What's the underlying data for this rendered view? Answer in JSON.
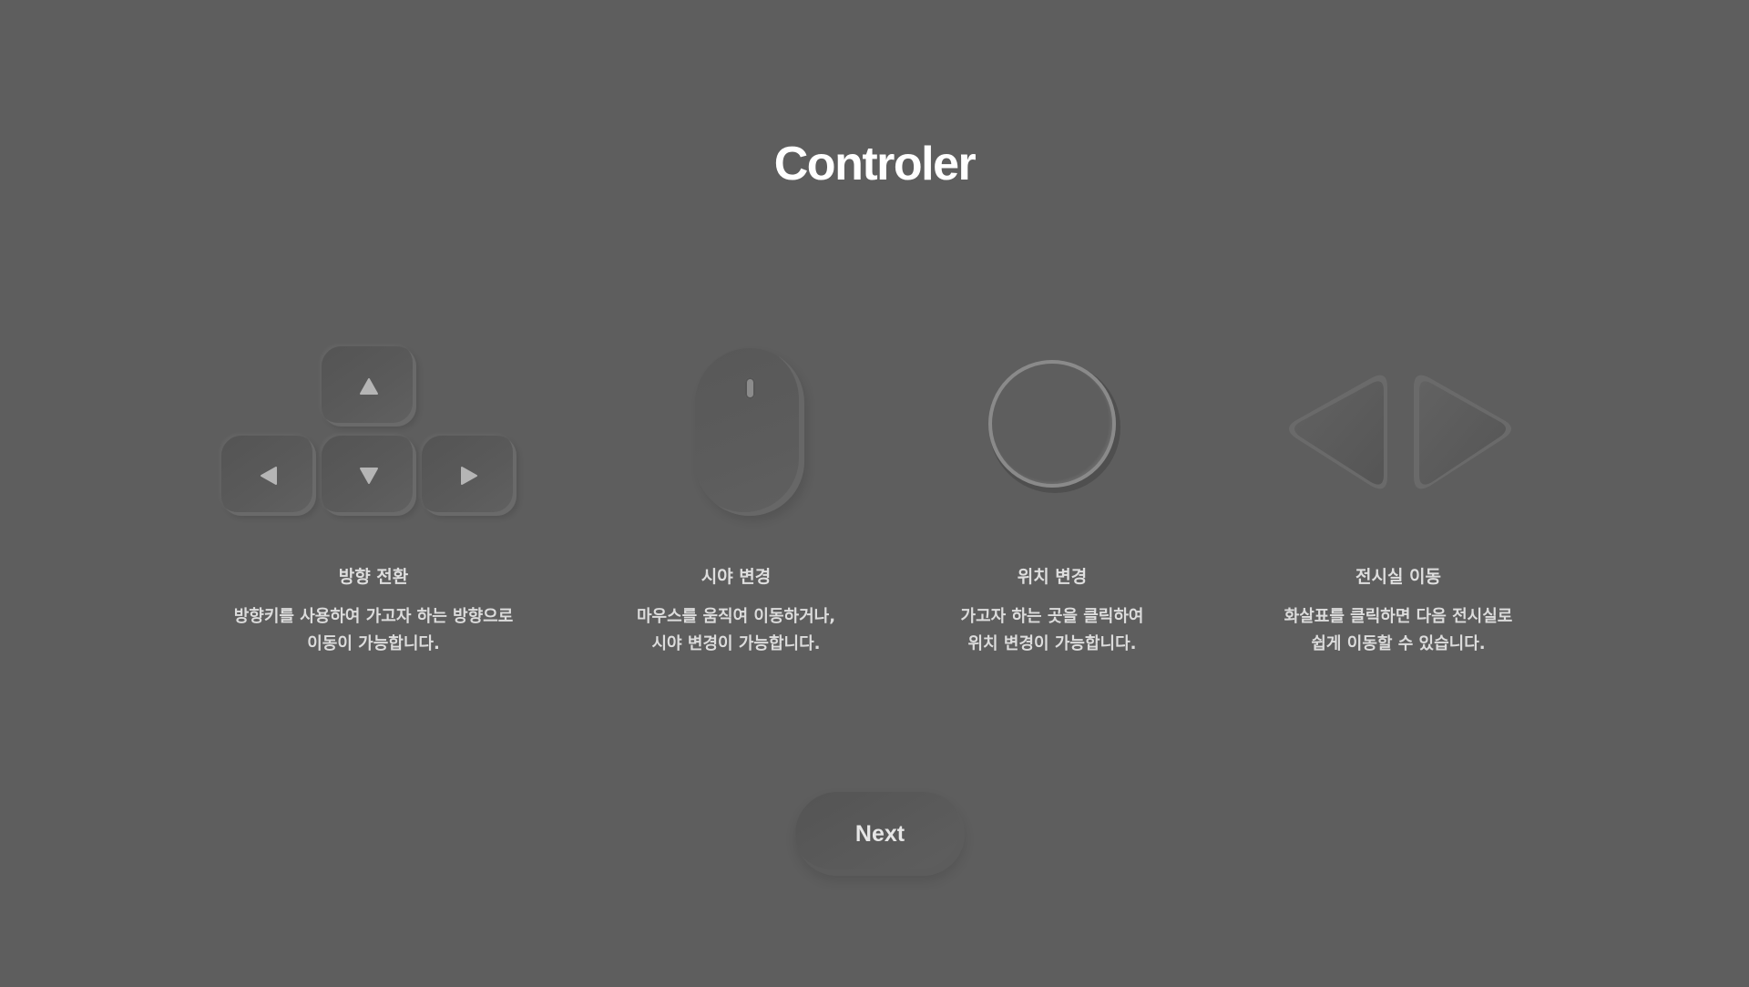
{
  "page": {
    "title": "Controler"
  },
  "cards": [
    {
      "icon": "arrow-keys-icon",
      "title": "방향 전환",
      "desc": [
        "방향키를 사용하여 가고자 하는 방향으로",
        "이동이 가능합니다."
      ]
    },
    {
      "icon": "mouse-icon",
      "title": "시야 변경",
      "desc": [
        "마우스를 움직여 이동하거나,",
        "시야 변경이 가능합니다."
      ]
    },
    {
      "icon": "circle-icon",
      "title": "위치 변경",
      "desc": [
        "가고자 하는 곳을 클릭하여",
        "위치 변경이 가능합니다."
      ]
    },
    {
      "icon": "left-right-arrows-icon",
      "title": "전시실 이동",
      "desc": [
        "화살표를 클릭하면 다음 전시실로",
        "쉽게 이동할 수 있습니다."
      ]
    }
  ],
  "actions": {
    "next_label": "Next"
  },
  "colors": {
    "background": "#5e5e5e",
    "title": "#ffffff",
    "text": "#dedede"
  }
}
